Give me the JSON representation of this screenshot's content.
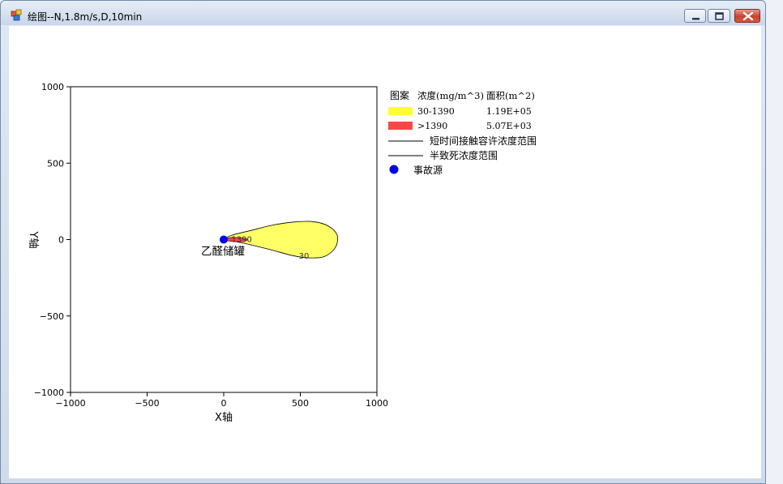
{
  "window": {
    "title": "绘图--N,1.8m/s,D,10min"
  },
  "chart_data": {
    "type": "contour",
    "xlabel": "X轴",
    "ylabel": "Y轴",
    "xlim": [
      -1000,
      1000
    ],
    "ylim": [
      -1000,
      1000
    ],
    "xticks": [
      "−1000",
      "−500",
      "0",
      "500",
      "1000"
    ],
    "yticks": [
      "1000",
      "500",
      "0",
      "−500",
      "−1000"
    ],
    "xtick_values": [
      -1000,
      -500,
      0,
      500,
      1000
    ],
    "ytick_values": [
      1000,
      500,
      0,
      -500,
      -1000
    ],
    "grid": false,
    "source": {
      "x": 0,
      "y": 0,
      "label": "乙醛储罐"
    },
    "contour_labels": [
      "1390",
      "30"
    ],
    "regions": [
      {
        "name": "30-1390",
        "color": "#ffff66",
        "outline": [
          [
            0,
            0
          ],
          [
            60,
            30
          ],
          [
            180,
            60
          ],
          [
            320,
            95
          ],
          [
            460,
            115
          ],
          [
            580,
            118
          ],
          [
            680,
            90
          ],
          [
            740,
            30
          ],
          [
            730,
            -50
          ],
          [
            660,
            -110
          ],
          [
            560,
            -120
          ],
          [
            450,
            -105
          ],
          [
            320,
            -70
          ],
          [
            180,
            -35
          ],
          [
            60,
            -10
          ]
        ]
      },
      {
        "name": ">1390",
        "color": "#ff4444",
        "outline": [
          [
            0,
            0
          ],
          [
            40,
            12
          ],
          [
            90,
            13
          ],
          [
            145,
            6
          ],
          [
            150,
            -6
          ],
          [
            110,
            -14
          ],
          [
            40,
            -10
          ]
        ]
      }
    ]
  },
  "legend": {
    "header": {
      "pattern": "图案",
      "conc": "浓度(mg/m^3)",
      "area": "面积(m^2)"
    },
    "items": [
      {
        "label": "30-1390",
        "area": "1.19E+05",
        "color": "#ffff33"
      },
      {
        "label": ">1390",
        "area": "5.07E+03",
        "color": "#ff4444"
      }
    ],
    "lines": [
      {
        "label": "短时间接触容许浓度范围"
      },
      {
        "label": "半致死浓度范围"
      }
    ],
    "source": {
      "label": "事故源",
      "color": "#0000ee"
    }
  }
}
